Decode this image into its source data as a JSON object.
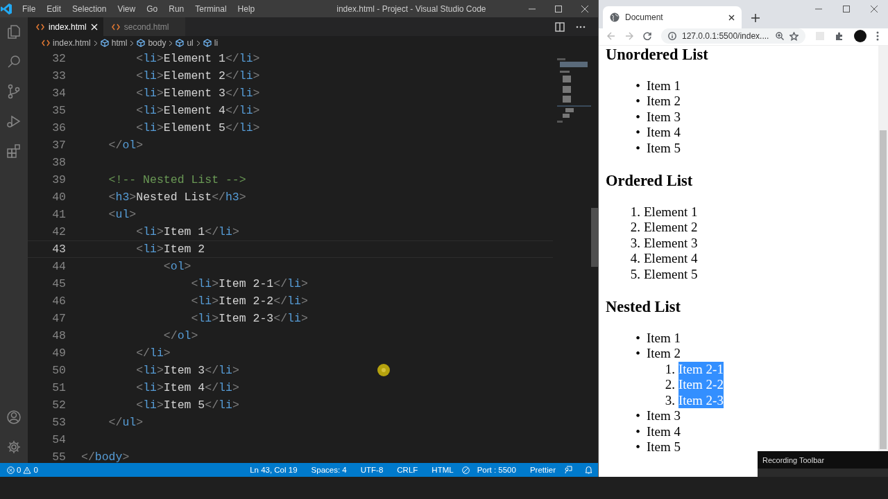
{
  "editor": {
    "window_title": "index.html - Project - Visual Studio Code",
    "menu": [
      "File",
      "Edit",
      "Selection",
      "View",
      "Go",
      "Run",
      "Terminal",
      "Help"
    ],
    "tabs": [
      {
        "label": "index.html",
        "selected": true
      },
      {
        "label": "second.html",
        "selected": false
      }
    ],
    "breadcrumb": [
      "index.html",
      "html",
      "body",
      "ul",
      "li"
    ],
    "lines": [
      {
        "number": "32",
        "text": "        <li>Element 1</li>",
        "current": false
      },
      {
        "number": "33",
        "text": "        <li>Element 2</li>",
        "current": false
      },
      {
        "number": "34",
        "text": "        <li>Element 3</li>",
        "current": false
      },
      {
        "number": "35",
        "text": "        <li>Element 4</li>",
        "current": false
      },
      {
        "number": "36",
        "text": "        <li>Element 5</li>",
        "current": false
      },
      {
        "number": "37",
        "text": "    </ol>",
        "current": false
      },
      {
        "number": "38",
        "current": false
      },
      {
        "number": "39",
        "text": "    <!-- Nested List -->",
        "current": false
      },
      {
        "number": "40",
        "text": "    <h3>Nested List</h3>",
        "current": false
      },
      {
        "number": "41",
        "text": "    <ul>",
        "current": false
      },
      {
        "number": "42",
        "text": "        <li>Item 1</li>",
        "current": false
      },
      {
        "number": "43",
        "text": "        <li>Item 2",
        "current": true
      },
      {
        "number": "44",
        "text": "            <ol>",
        "current": false
      },
      {
        "number": "45",
        "text": "                <li>Item 2-1</li>",
        "current": false
      },
      {
        "number": "46",
        "text": "                <li>Item 2-2</li>",
        "current": false
      },
      {
        "number": "47",
        "text": "                <li>Item 2-3</li>",
        "current": false
      },
      {
        "number": "48",
        "text": "            </ol>",
        "current": false
      },
      {
        "number": "49",
        "text": "        </li>",
        "current": false
      },
      {
        "number": "50",
        "text": "        <li>Item 3</li>",
        "current": false
      },
      {
        "number": "51",
        "text": "        <li>Item 4</li>",
        "current": false
      },
      {
        "number": "52",
        "text": "        <li>Item 5</li>",
        "current": false
      },
      {
        "number": "53",
        "text": "    </ul>",
        "current": false
      },
      {
        "number": "54",
        "current": false
      },
      {
        "number": "55",
        "text": "</body>",
        "current": false
      }
    ]
  },
  "status_bar": {
    "errors": "0",
    "warnings": "0",
    "items": [
      "Ln 43, Col 19",
      "Spaces: 4",
      "UTF-8",
      "CRLF",
      "HTML"
    ],
    "port": "Port : 5500",
    "formatter": "Prettier"
  },
  "browser": {
    "tab": "Document",
    "url": "127.0.0.1:5500/index....",
    "sections": [
      {
        "heading": "Unordered List",
        "items": [
          {
            "marker": "•",
            "text": "Item 1",
            "selected": false
          },
          {
            "marker": "•",
            "text": "Item 2",
            "selected": false
          },
          {
            "marker": "•",
            "text": "Item 3",
            "selected": false
          },
          {
            "marker": "•",
            "text": "Item 4",
            "selected": false
          },
          {
            "marker": "•",
            "text": "Item 5",
            "selected": false
          }
        ]
      },
      {
        "heading": "Ordered List",
        "items": [
          {
            "marker": "1.",
            "text": "Element 1",
            "selected": false
          },
          {
            "marker": "2.",
            "text": "Element 2",
            "selected": false
          },
          {
            "marker": "3.",
            "text": "Element 3",
            "selected": false
          },
          {
            "marker": "4.",
            "text": "Element 4",
            "selected": false
          },
          {
            "marker": "5.",
            "text": "Element 5",
            "selected": false
          }
        ]
      },
      {
        "heading": "Nested List",
        "items": [
          {
            "marker": "•",
            "text": "Item 1",
            "selected": false
          },
          {
            "marker": "•",
            "text": "Item 2",
            "selected": false,
            "children": [
              {
                "marker": "1.",
                "text": "Item 2-1",
                "selected": true
              },
              {
                "marker": "2.",
                "text": "Item 2-2",
                "selected": true
              },
              {
                "marker": "3.",
                "text": "Item 2-3",
                "selected": true
              }
            ]
          },
          {
            "marker": "•",
            "text": "Item 3",
            "selected": false
          },
          {
            "marker": "•",
            "text": "Item 4",
            "selected": false
          },
          {
            "marker": "•",
            "text": "Item 5",
            "selected": false
          }
        ]
      }
    ]
  },
  "recording_toolbar": {
    "title": "Recording Toolbar"
  }
}
